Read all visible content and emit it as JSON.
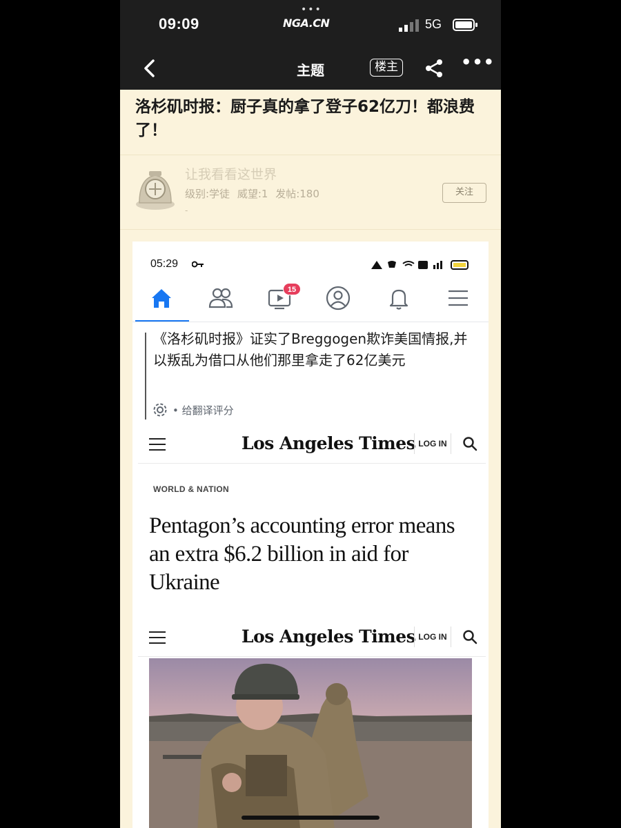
{
  "status_bar": {
    "time": "09:09",
    "app_brand": "NGA.CN",
    "network": "5G"
  },
  "nav": {
    "title": "主题",
    "op_label": "楼主"
  },
  "topic": {
    "title": "洛杉矶时报：厨子真的拿了登子62亿刀！都浪费了！"
  },
  "author": {
    "name": "让我看看这世界",
    "meta": "级别:学徒 威望:1 发帖:180",
    "extra": "-",
    "follow_label": "关注"
  },
  "screenshot": {
    "status_time": "05:29",
    "video_badge": "15",
    "translated_text": "《洛杉矶时报》证实了Breggogen欺诈美国情报,并以叛乱为借口从他们那里拿走了62亿美元",
    "rate_label": "• 给翻译评分",
    "lat_header_1": {
      "logo": "Los Angeles Times",
      "login": "LOG IN"
    },
    "section_label": "WORLD & NATION",
    "headline": "Pentagon’s accounting error means an extra $6.2 billion in aid for Ukraine",
    "lat_header_2": {
      "logo": "Los Angeles Times",
      "login": "LOG IN"
    }
  },
  "colors": {
    "nav_bg": "#1e1e1e",
    "page_bg": "#fbf3dc",
    "fb_blue": "#1877f2",
    "badge_red": "#e63e5c"
  }
}
